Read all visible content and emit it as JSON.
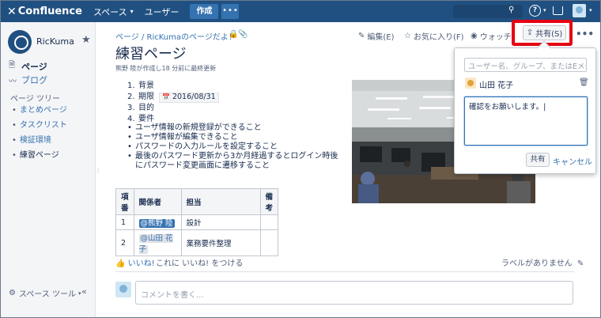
{
  "topnav": {
    "logo": "Confluence",
    "spaces": "スペース",
    "people": "ユーザー",
    "create": "作成",
    "more": "•••"
  },
  "sidebar": {
    "space_name": "RicKuma",
    "links": [
      {
        "label": "ページ",
        "icon": "pages-icon"
      },
      {
        "label": "ブログ",
        "icon": "blog-icon"
      }
    ],
    "tree_title": "ページ ツリー",
    "tree_items": [
      {
        "label": "まとめページ"
      },
      {
        "label": "タスクリスト"
      },
      {
        "label": "検証環境"
      },
      {
        "label": "練習ページ"
      }
    ],
    "footer": "スペース ツール"
  },
  "page": {
    "breadcrumb": "ページ / RicKumaのページだよ！",
    "actions": {
      "edit": "編集(E)",
      "favorite": "お気に入り(F)",
      "watch": "ウォッチ中(W)",
      "share": "共有(S)"
    },
    "title": "練習ページ",
    "byline": "熊野 陸が作成し18 分前に最終更新",
    "numbered": [
      {
        "num": "1.",
        "text": "背景"
      },
      {
        "num": "2.",
        "text": "期限",
        "date": "2016/08/31"
      },
      {
        "num": "3.",
        "text": "目的"
      },
      {
        "num": "4.",
        "text": "要件"
      }
    ],
    "bullets": [
      "ユーザ情報の新規登録ができること",
      "ユーザ情報が編集できること",
      "パスワードの入力ルールを設定すること",
      "最後のパスワード更新から3か月経過するとログイン時後にパスワード変更画面に遷移すること"
    ],
    "table": {
      "headers": [
        "項番",
        "関係者",
        "担当",
        "備考"
      ],
      "rows": [
        {
          "no": "1",
          "person": "@熊野 陸",
          "role": "設計",
          "note": ""
        },
        {
          "no": "2",
          "person": "@山田 花子",
          "role": "業務要件整理",
          "note": ""
        }
      ]
    },
    "like": "いいね!",
    "like_hint": "これに いいね! をつける",
    "labels_empty": "ラベルがありません",
    "comment_placeholder": "コメントを書く..."
  },
  "share_dialog": {
    "user_placeholder": "ユーザー名、グループ、またはEメール",
    "recipient": "山田 花子",
    "message": "確認をお願いします。",
    "share_button": "共有",
    "cancel": "キャンセル"
  },
  "colors": {
    "header": "#205081",
    "link": "#3572b0",
    "highlight": "#e60012"
  }
}
